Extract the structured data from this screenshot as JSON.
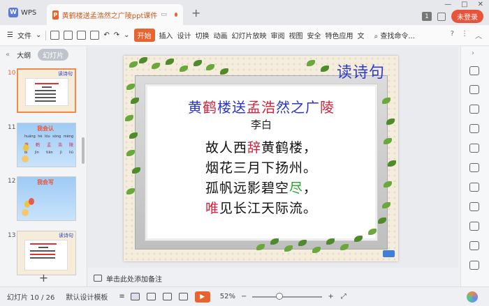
{
  "window": {
    "app_tab": "WPS",
    "doc_tab": "黄鹤楼送孟浩然之广陵ppt课件",
    "new_tab": "+",
    "badge": "1",
    "login": "未登录"
  },
  "toolbar": {
    "file": "文件",
    "menus": [
      "开始",
      "插入",
      "设计",
      "切换",
      "动画",
      "幻灯片放映",
      "审阅",
      "视图",
      "安全",
      "特色应用",
      "文"
    ],
    "search": "查找命令...",
    "help": "?"
  },
  "left_pane": {
    "tab_outline": "大纲",
    "tab_slides": "幻灯片",
    "slides": [
      {
        "num": "10",
        "title": "读诗句",
        "active": true
      },
      {
        "num": "11",
        "title": "我会认",
        "rows": [
          [
            "huáng",
            "hè",
            "lóu",
            "sòng",
            "mèng"
          ],
          [
            "黄",
            "鹤",
            "孟",
            "浩",
            "陵"
          ],
          [
            "bì",
            "jìn",
            "tiān",
            "jì",
            "liú"
          ]
        ]
      },
      {
        "num": "12",
        "title": "我会写"
      },
      {
        "num": "13",
        "title": "读诗句"
      }
    ],
    "add": "+"
  },
  "slide": {
    "corner_title": "读诗句",
    "title_parts": [
      {
        "t": "黄",
        "c": "b"
      },
      {
        "t": "鹤",
        "c": "r"
      },
      {
        "t": "楼送",
        "c": "b"
      },
      {
        "t": "孟浩",
        "c": "r"
      },
      {
        "t": "然之广",
        "c": "b"
      },
      {
        "t": "陵",
        "c": "r"
      }
    ],
    "author": "李白",
    "lines": [
      [
        {
          "t": "故人西",
          "c": "k"
        },
        {
          "t": "辞",
          "c": "r"
        },
        {
          "t": "黄鹤楼，",
          "c": "k"
        }
      ],
      [
        {
          "t": "烟花三月下扬州。",
          "c": "k"
        }
      ],
      [
        {
          "t": "孤帆远影碧空",
          "c": "k"
        },
        {
          "t": "尽",
          "c": "g"
        },
        {
          "t": "，",
          "c": "k"
        }
      ],
      [
        {
          "t": "唯",
          "c": "r"
        },
        {
          "t": "见长江天际流。",
          "c": "k"
        }
      ]
    ]
  },
  "notes": {
    "placeholder": "单击此处添加备注"
  },
  "status": {
    "slide_counter": "幻灯片 10 / 26",
    "template": "默认设计模板",
    "zoom": "52%",
    "minus": "−",
    "plus": "+"
  },
  "colors": {
    "accent": "#e8642e",
    "title_blue": "#2a3bd8",
    "red": "#d3233b",
    "green": "#25a62a"
  }
}
